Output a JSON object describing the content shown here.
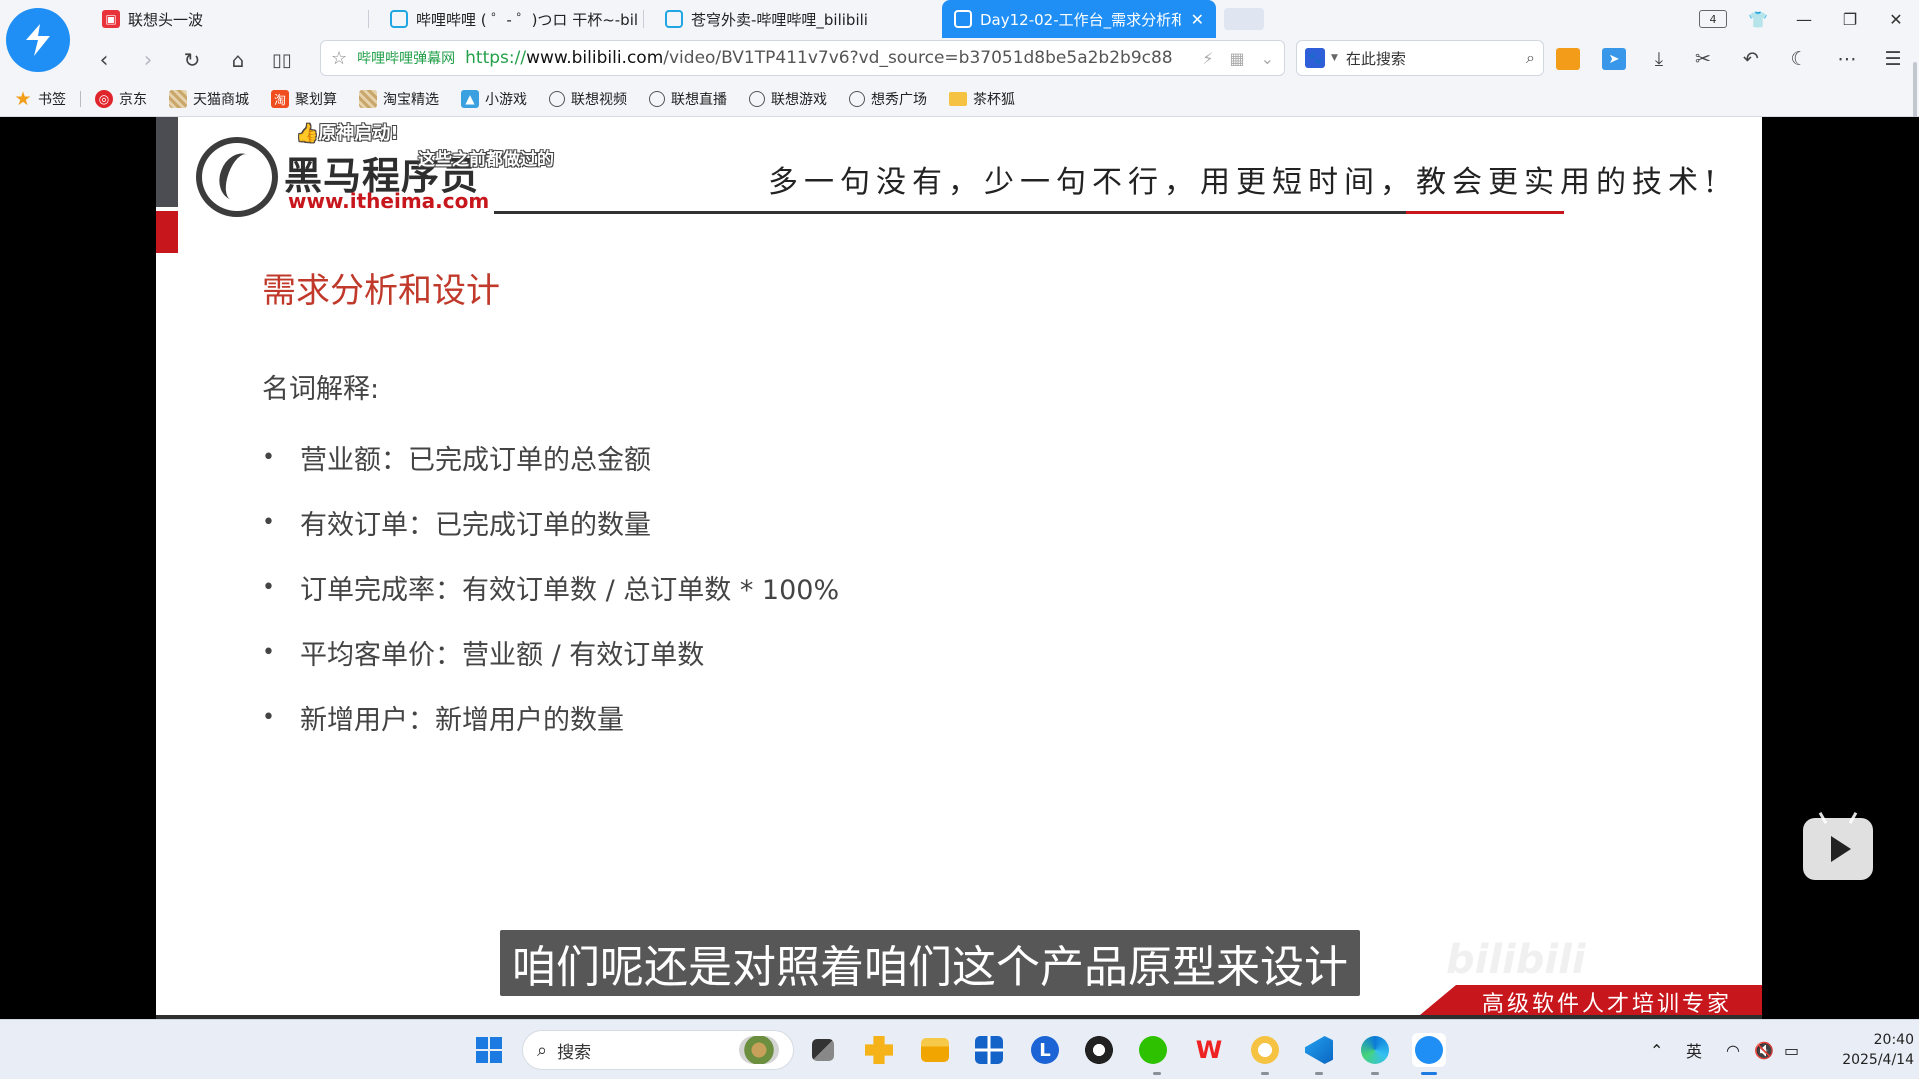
{
  "browser": {
    "tabs": [
      {
        "label": "联想头一波",
        "icon": "lenovo-news-icon",
        "active": false
      },
      {
        "label": "哔哩哔哩 ( ゜- ゜)つロ 干杯~-bilib",
        "icon": "bilibili-tv-icon",
        "active": false
      },
      {
        "label": "苍穹外卖-哔哩哔哩_bilibili",
        "icon": "bilibili-tv-icon",
        "active": false
      },
      {
        "label": "Day12-02-工作台_需求分析和i",
        "icon": "bilibili-tv-icon",
        "active": true
      }
    ],
    "tab_count": "4",
    "address": {
      "site_label": "哔哩哔哩弹幕网",
      "scheme": "https://",
      "host": "www.bilibili.com",
      "path": "/video/BV1TP411v7v6?vd_source=b37051d8be5a2b2b9c88"
    },
    "search_placeholder": "在此搜索",
    "bookmarks": [
      {
        "label": "书签",
        "icon": "star-icon"
      },
      {
        "label": "京东",
        "icon": "jd-icon"
      },
      {
        "label": "天猫商城",
        "icon": "tmall-icon"
      },
      {
        "label": "聚划算",
        "icon": "juhuasuan-icon"
      },
      {
        "label": "淘宝精选",
        "icon": "taobao-icon"
      },
      {
        "label": "小游戏",
        "icon": "mini-game-icon"
      },
      {
        "label": "联想视频",
        "icon": "globe-icon"
      },
      {
        "label": "联想直播",
        "icon": "globe-icon"
      },
      {
        "label": "联想游戏",
        "icon": "globe-icon"
      },
      {
        "label": "想秀广场",
        "icon": "globe-icon"
      },
      {
        "label": "茶杯狐",
        "icon": "folder-icon"
      }
    ]
  },
  "slide": {
    "brand_name": "黑马程序员",
    "brand_url": "www.itheima.com",
    "slogan": "多一句没有，少一句不行，用更短时间，教会更实用的技术!",
    "title": "需求分析和设计",
    "section_label": "名词解释:",
    "bullets": [
      "营业额：已完成订单的总金额",
      "有效订单：已完成订单的数量",
      "订单完成率：有效订单数 / 总订单数 * 100%",
      "平均客单价：营业额 / 有效订单数",
      "新增用户：新增用户的数量"
    ],
    "footer_text": "高级软件人才培训专家"
  },
  "overlay": {
    "danmaku": [
      "👍原神启动!",
      "这些之前都做过的"
    ],
    "subtitle": "咱们呢还是对照着咱们这个产品原型来设计"
  },
  "taskbar": {
    "search_label": "搜索",
    "ime": "英",
    "time": "20:40",
    "date": "2025/4/14"
  },
  "colors": {
    "browser_accent": "#1f8ff5",
    "slide_title": "#c0392b",
    "brand_red": "#c8161d"
  }
}
